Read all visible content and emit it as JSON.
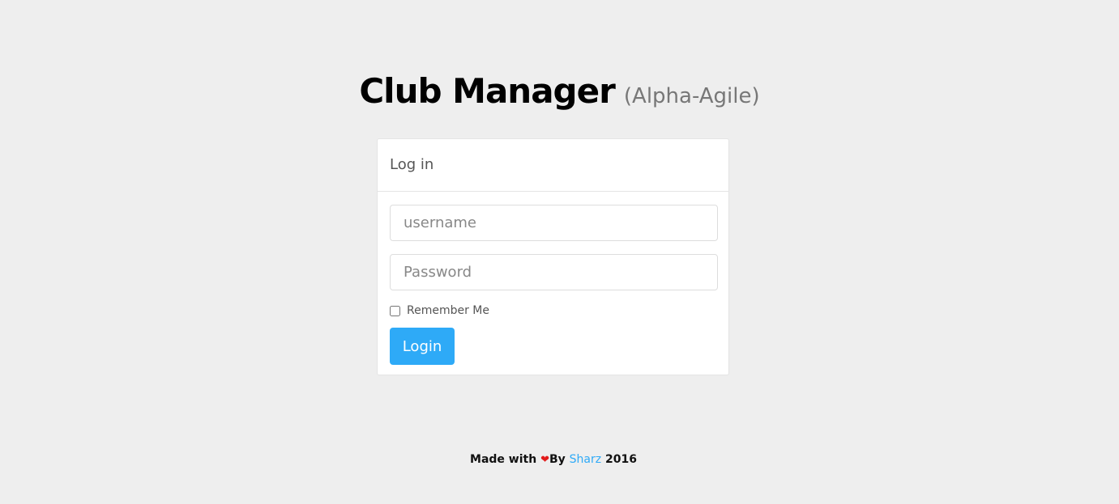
{
  "header": {
    "title": "Club Manager",
    "subtitle": "(Alpha-Agile)"
  },
  "login_panel": {
    "heading": "Log in",
    "username_placeholder": "username",
    "password_placeholder": "Password",
    "remember_label": "Remember Me",
    "remember_checked": false,
    "submit_label": "Login"
  },
  "footer": {
    "made_with": "Made with",
    "heart_icon": "heart-icon",
    "by": "By",
    "author": "Sharz",
    "year": "2016"
  },
  "colors": {
    "background": "#eeeeee",
    "accent": "#2eaaf7",
    "heart": "#e21b1b"
  }
}
